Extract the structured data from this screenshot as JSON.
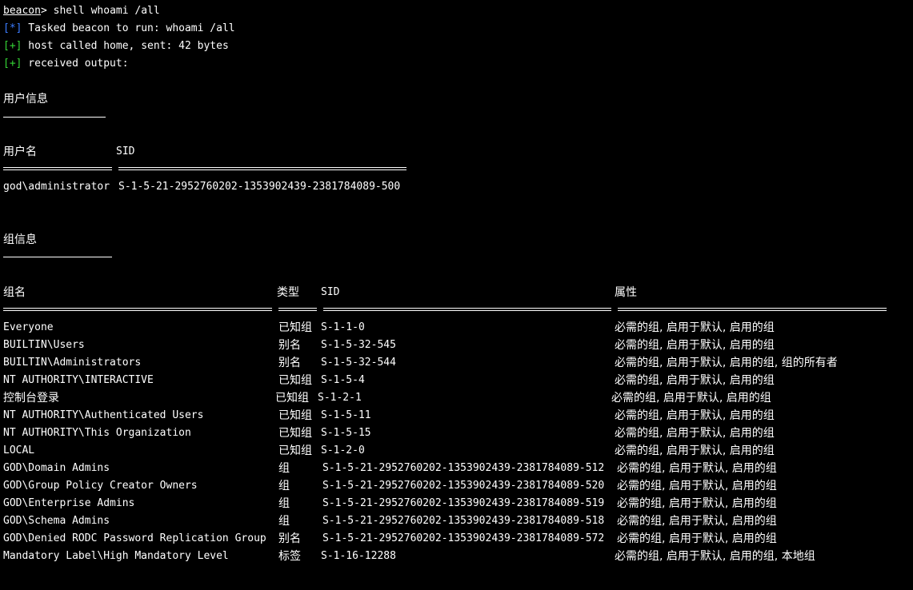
{
  "console": {
    "prompt": "beacon",
    "prompt_sep": "> ",
    "command": "shell whoami /all",
    "lines": [
      {
        "tag": "[*]",
        "text": " Tasked beacon to run: whoami /all"
      },
      {
        "tag": "[+]",
        "text": " host called home, sent: 42 bytes"
      },
      {
        "tag": "[+]",
        "text": " received output:"
      }
    ]
  },
  "user_info": {
    "heading": "用户信息",
    "col_username": "用户名",
    "col_sid": "SID",
    "username": "god\\administrator",
    "sid": "S-1-5-21-2952760202-1353902439-2381784089-500"
  },
  "group_info": {
    "heading": "组信息",
    "col_name": "组名",
    "col_type": "类型",
    "col_sid": "SID",
    "col_attr": "属性",
    "rows": [
      {
        "name": "Everyone",
        "type": "已知组",
        "sid": "S-1-1-0",
        "attr": "必需的组, 启用于默认, 启用的组"
      },
      {
        "name": "BUILTIN\\Users",
        "type": "别名",
        "sid": "S-1-5-32-545",
        "attr": "必需的组, 启用于默认, 启用的组"
      },
      {
        "name": "BUILTIN\\Administrators",
        "type": "别名",
        "sid": "S-1-5-32-544",
        "attr": "必需的组, 启用于默认, 启用的组, 组的所有者"
      },
      {
        "name": "NT AUTHORITY\\INTERACTIVE",
        "type": "已知组",
        "sid": "S-1-5-4",
        "attr": "必需的组, 启用于默认, 启用的组"
      },
      {
        "name": "控制台登录",
        "type": "已知组",
        "sid": "S-1-2-1",
        "attr": "必需的组, 启用于默认, 启用的组"
      },
      {
        "name": "NT AUTHORITY\\Authenticated Users",
        "type": "已知组",
        "sid": "S-1-5-11",
        "attr": "必需的组, 启用于默认, 启用的组"
      },
      {
        "name": "NT AUTHORITY\\This Organization",
        "type": "已知组",
        "sid": "S-1-5-15",
        "attr": "必需的组, 启用于默认, 启用的组"
      },
      {
        "name": "LOCAL",
        "type": "已知组",
        "sid": "S-1-2-0",
        "attr": "必需的组, 启用于默认, 启用的组"
      },
      {
        "name": "GOD\\Domain Admins",
        "type": "组",
        "sid": "S-1-5-21-2952760202-1353902439-2381784089-512",
        "attr": "必需的组, 启用于默认, 启用的组"
      },
      {
        "name": "GOD\\Group Policy Creator Owners",
        "type": "组",
        "sid": "S-1-5-21-2952760202-1353902439-2381784089-520",
        "attr": "必需的组, 启用于默认, 启用的组"
      },
      {
        "name": "GOD\\Enterprise Admins",
        "type": "组",
        "sid": "S-1-5-21-2952760202-1353902439-2381784089-519",
        "attr": "必需的组, 启用于默认, 启用的组"
      },
      {
        "name": "GOD\\Schema Admins",
        "type": "组",
        "sid": "S-1-5-21-2952760202-1353902439-2381784089-518",
        "attr": "必需的组, 启用于默认, 启用的组"
      },
      {
        "name": "GOD\\Denied RODC Password Replication Group",
        "type": "别名",
        "sid": "S-1-5-21-2952760202-1353902439-2381784089-572",
        "attr": "必需的组, 启用于默认, 启用的组"
      },
      {
        "name": "Mandatory Label\\High Mandatory Level",
        "type": "标签",
        "sid": "S-1-16-12288",
        "attr": "必需的组, 启用于默认, 启用的组, 本地组"
      }
    ]
  },
  "colors": {
    "background": "#000000",
    "text": "#ffffff",
    "tag_info": "#3b7cff",
    "tag_success": "#35d435"
  }
}
